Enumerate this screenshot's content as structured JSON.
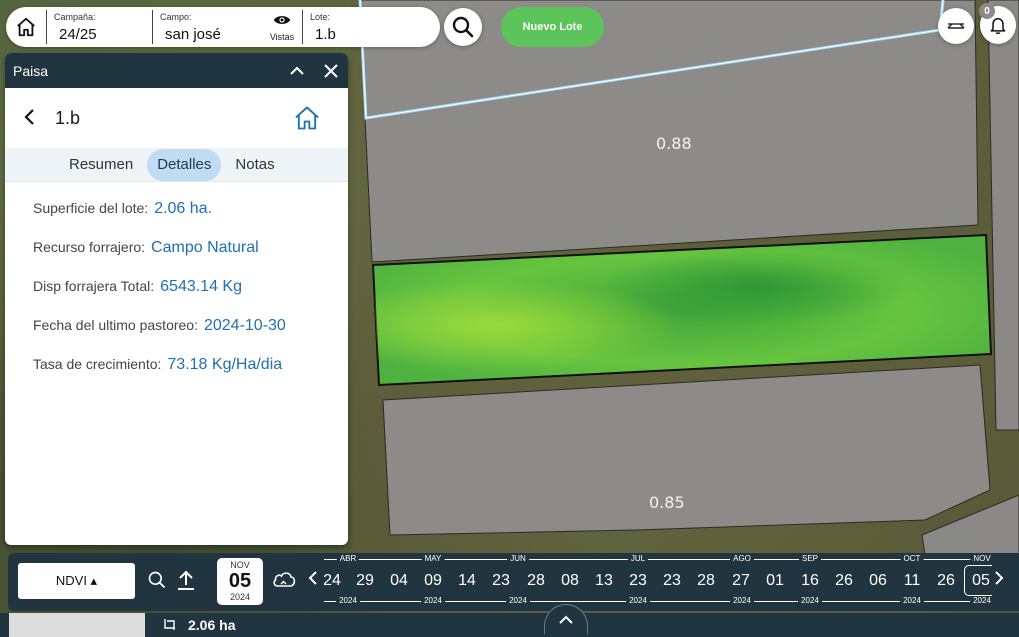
{
  "topbar": {
    "campana_label": "Campaña:",
    "campana_value": "24/25",
    "campo_label": "Campo:",
    "campo_value": "san josé",
    "vistas_label": "Vistas",
    "lote_label": "Lote:",
    "lote_value": "1.b",
    "nuevo_lote": "Nuevo Lote",
    "notifications_count": "0"
  },
  "map": {
    "labels": [
      "0.88",
      "0.85"
    ]
  },
  "panel": {
    "title": "Paisa",
    "lote_name": "1.b",
    "tabs": [
      {
        "label": "Resumen",
        "active": false
      },
      {
        "label": "Detalles",
        "active": true
      },
      {
        "label": "Notas",
        "active": false
      }
    ],
    "details": [
      {
        "key": "Superficie del lote:",
        "value": "2.06 ha."
      },
      {
        "key": "Recurso forrajero:",
        "value": "Campo Natural"
      },
      {
        "key": "Disp forrajera Total:",
        "value": "6543.14 Kg"
      },
      {
        "key": "Fecha del ultimo pastoreo:",
        "value": "2024-10-30"
      },
      {
        "key": "Tasa de crecimiento:",
        "value": "73.18 Kg/Ha/dia"
      }
    ]
  },
  "bottombar": {
    "layer": "NDVI ▴",
    "selected_date": {
      "month": "NOV",
      "day": "05",
      "year": "2024"
    },
    "months": [
      "ABR",
      "MAY",
      "JUN",
      "JUL",
      "AGO",
      "SEP",
      "OCT",
      "NOV"
    ],
    "year": "2024",
    "days": [
      "24",
      "29",
      "04",
      "09",
      "14",
      "23",
      "28",
      "08",
      "13",
      "23",
      "23",
      "28",
      "27",
      "01",
      "16",
      "26",
      "06",
      "11",
      "26",
      "05"
    ],
    "selected_day": "05"
  },
  "footer": {
    "area": "2.06 ha"
  },
  "colors": {
    "accent": "#213540",
    "link": "#1e70b5",
    "green_button": "#5cc45a",
    "active_tab": "#bfdcf2"
  }
}
